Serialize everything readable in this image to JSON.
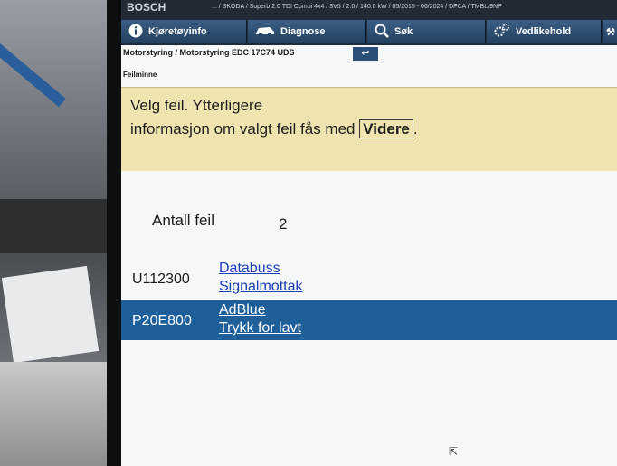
{
  "topbar": {
    "brand": "BOSCH",
    "vehicle_info": "  ... / SKODA / Superb 2.0 TDI Combi 4x4 / 3V5 / 2.0 / 140.0 kW / 05/2015 - 06/2024 / DFCA / TMBL/9NP"
  },
  "tabs": [
    {
      "label": "Kjøretøyinfo",
      "icon": "info-icon"
    },
    {
      "label": "Diagnose",
      "icon": "car-icon"
    },
    {
      "label": "Søk",
      "icon": "search-icon"
    },
    {
      "label": "Vedlikehold",
      "icon": "gears-icon"
    },
    {
      "label": "",
      "icon": "wrench-icon"
    }
  ],
  "breadcrumb": "Motorstyring / Motorstyring EDC 17C74 UDS",
  "back_icon": "back-arrow-icon",
  "section_title": "Feilminne",
  "message": {
    "line1": "Velg feil. Ytterligere",
    "line2_prefix": "informasjon om valgt feil fås med ",
    "button": "Videre",
    "line2_suffix": "."
  },
  "fault_count": {
    "label": "Antall feil",
    "value": "2"
  },
  "faults": [
    {
      "code": "U112300",
      "line1": "Databuss",
      "line2": "Signalmottak",
      "selected": false
    },
    {
      "code": "P20E800",
      "line1": "AdBlue",
      "line2": "Trykk for lavt",
      "selected": true
    }
  ],
  "colors": {
    "accent": "#1f5f99",
    "message_bg": "#efe3b0",
    "tab_bg": "#23415f",
    "link": "#1b3fb5"
  }
}
